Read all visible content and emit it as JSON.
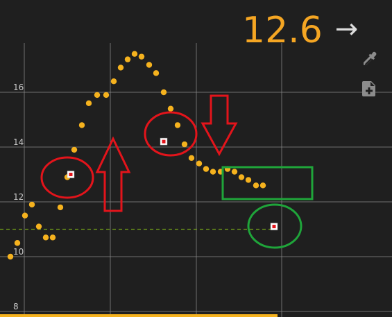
{
  "readout": {
    "value": "12.6",
    "arrow": "→"
  },
  "toolbar": {
    "eyedropper": "eyedropper-icon",
    "add_file": "add-file-icon"
  },
  "colors": {
    "background": "#1f1f1f",
    "grid": "#8a8a8a",
    "points": "#f5b21e",
    "readout": "#f5a623",
    "annotation_red": "#e3141b",
    "annotation_green": "#1fa53a",
    "threshold": "#6f9a1a",
    "marker_fill": "#ffffff",
    "marker_center": "#e3141b"
  },
  "chart_data": {
    "type": "scatter",
    "ylim": [
      8,
      17.8
    ],
    "xlim": [
      0,
      565
    ],
    "y_ticks": [
      {
        "value": 8,
        "label": "8"
      },
      {
        "value": 10,
        "label": "10"
      },
      {
        "value": 12,
        "label": "12"
      },
      {
        "value": 14,
        "label": "14"
      },
      {
        "value": 16,
        "label": "16"
      }
    ],
    "threshold": 11,
    "points": [
      [
        15,
        10.0
      ],
      [
        25,
        10.5
      ],
      [
        36,
        11.5
      ],
      [
        46,
        11.9
      ],
      [
        56,
        11.1
      ],
      [
        66,
        10.7
      ],
      [
        76,
        10.7
      ],
      [
        87,
        11.8
      ],
      [
        97,
        12.9
      ],
      [
        107,
        13.9
      ],
      [
        118,
        14.8
      ],
      [
        128,
        15.6
      ],
      [
        140,
        15.9
      ],
      [
        153,
        15.9
      ],
      [
        164,
        16.4
      ],
      [
        174,
        16.9
      ],
      [
        184,
        17.2
      ],
      [
        194,
        17.4
      ],
      [
        204,
        17.3
      ],
      [
        215,
        17.0
      ],
      [
        225,
        16.7
      ],
      [
        236,
        16.0
      ],
      [
        246,
        15.4
      ],
      [
        256,
        14.8
      ],
      [
        266,
        14.1
      ],
      [
        276,
        13.6
      ],
      [
        287,
        13.4
      ],
      [
        297,
        13.2
      ],
      [
        307,
        13.1
      ],
      [
        318,
        13.1
      ],
      [
        328,
        13.2
      ],
      [
        338,
        13.1
      ],
      [
        348,
        12.9
      ],
      [
        358,
        12.8
      ],
      [
        369,
        12.6
      ],
      [
        379,
        12.6
      ]
    ],
    "highlighted_points": [
      [
        102,
        13.0
      ],
      [
        236,
        14.2
      ],
      [
        395,
        11.1
      ]
    ]
  }
}
